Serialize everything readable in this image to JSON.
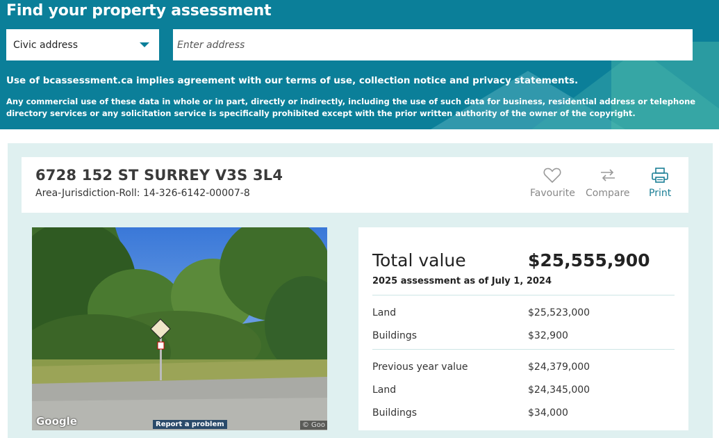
{
  "header": {
    "title": "Find your property assessment",
    "search_type": "Civic address",
    "address_placeholder": "Enter address",
    "terms_notice": "Use of bcassessment.ca implies agreement with our terms of use, collection notice and privacy statements.",
    "commercial_notice": "Any commercial use of these data in whole or in part, directly or indirectly, including the use of such data for business, residential address or telephone directory services or any solicitation service is specifically prohibited except with the prior written authority of the owner of the copyright."
  },
  "property": {
    "address": "6728 152 ST SURREY V3S 3L4",
    "roll": "Area-Jurisdiction-Roll: 14-326-6142-00007-8"
  },
  "actions": {
    "favourite": "Favourite",
    "compare": "Compare",
    "print": "Print"
  },
  "photo": {
    "google_logo": "Google",
    "report_link": "Report a problem",
    "copyright": "© Goo"
  },
  "assessment": {
    "total_label": "Total value",
    "total_value": "$25,555,900",
    "date_line": "2025 assessment as of July 1, 2024",
    "land_label": "Land",
    "land_value": "$25,523,000",
    "buildings_label": "Buildings",
    "buildings_value": "$32,900",
    "prev_label": "Previous year value",
    "prev_value": "$24,379,000",
    "prev_land_label": "Land",
    "prev_land_value": "$24,345,000",
    "prev_buildings_label": "Buildings",
    "prev_buildings_value": "$34,000"
  },
  "colors": {
    "brand_teal": "#0b7f99",
    "panel_bg": "#dff0f0",
    "print_accent": "#1a7e96"
  }
}
